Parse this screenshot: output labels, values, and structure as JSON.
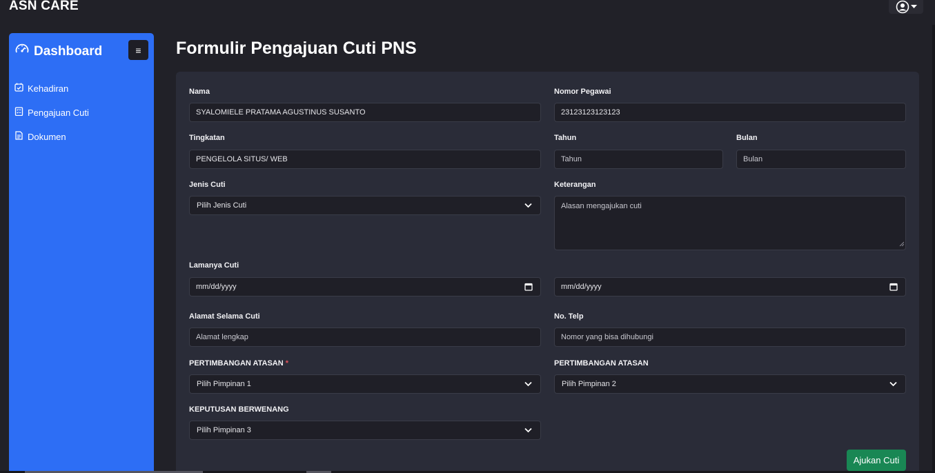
{
  "app": {
    "brand": "ASN CARE"
  },
  "user_menu": {
    "icon": "user-circle-icon"
  },
  "sidebar": {
    "title": "Dashboard",
    "title_icon": "speedometer-icon",
    "toggle_label": "≡",
    "items": [
      {
        "label": "Kehadiran",
        "icon": "calendar-check-icon"
      },
      {
        "label": "Pengajuan Cuti",
        "icon": "clipboard-list-icon"
      },
      {
        "label": "Dokumen",
        "icon": "document-icon"
      }
    ]
  },
  "page": {
    "title": "Formulir Pengajuan Cuti PNS"
  },
  "form": {
    "nama": {
      "label": "Nama",
      "value": "SYALOMIELE PRATAMA AGUSTINUS SUSANTO"
    },
    "nomor_pegawai": {
      "label": "Nomor Pegawai",
      "value": "23123123123123"
    },
    "tingkatan": {
      "label": "Tingkatan",
      "value": "PENGELOLA SITUS/ WEB"
    },
    "tahun": {
      "label": "Tahun",
      "placeholder": "Tahun"
    },
    "bulan": {
      "label": "Bulan",
      "placeholder": "Bulan"
    },
    "jenis_cuti": {
      "label": "Jenis Cuti",
      "selected": "Pilih Jenis Cuti"
    },
    "keterangan": {
      "label": "Keterangan",
      "placeholder": "Alasan mengajukan cuti"
    },
    "lamanya_cuti": {
      "label": "Lamanya Cuti",
      "start_placeholder": "mm/dd/yyyy",
      "end_placeholder": "mm/dd/yyyy"
    },
    "alamat": {
      "label": "Alamat Selama Cuti",
      "placeholder": "Alamat lengkap"
    },
    "telp": {
      "label": "No. Telp",
      "placeholder": "Nomor yang bisa dihubungi"
    },
    "pertimbangan_1": {
      "label": "PERTIMBANGAN ATASAN",
      "required_mark": "*",
      "selected": "Pilih Pimpinan 1"
    },
    "pertimbangan_2": {
      "label": "PERTIMBANGAN ATASAN",
      "selected": "Pilih Pimpinan 2"
    },
    "keputusan": {
      "label": "KEPUTUSAN BERWENANG",
      "selected": "Pilih Pimpinan 3"
    },
    "submit_label": "Ajukan Cuti"
  },
  "colors": {
    "sidebar": "#2d6ef5",
    "background": "#212128",
    "card": "#2a2c38",
    "submit": "#198754",
    "required": "#e0525a"
  }
}
